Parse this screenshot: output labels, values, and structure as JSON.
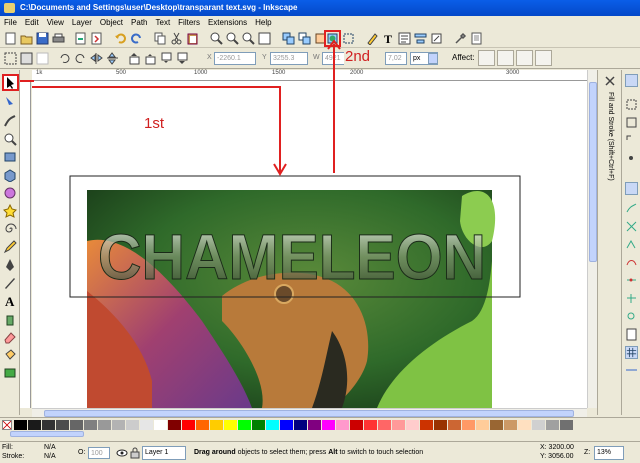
{
  "window": {
    "title": "C:\\Documents and Settings\\user\\Desktop\\transparant text.svg - Inkscape"
  },
  "menu": [
    "File",
    "Edit",
    "View",
    "Layer",
    "Object",
    "Path",
    "Text",
    "Filters",
    "Extensions",
    "Help"
  ],
  "toolbar2": {
    "x_label": "X",
    "x_value": "-2260.1",
    "y_label": "Y",
    "y_value": "3255.3",
    "w_label": "W",
    "w_value": "4921",
    "h_value": "7,02",
    "unit": "px",
    "affect_label": "Affect:"
  },
  "ruler": {
    "h_marks": [
      "1k",
      "500",
      "1000",
      "1500",
      "2000",
      "3000"
    ],
    "v_marks": [
      "1k",
      "1000",
      "1500",
      "2000",
      "2500",
      "3000"
    ]
  },
  "canvas": {
    "image_text": "CHAMELEON"
  },
  "annotations": {
    "first": "1st",
    "second": "2nd"
  },
  "dock": {
    "tab_label": "Fill and Stroke (Shift+Ctrl+F)"
  },
  "palette_colors": [
    "#000000",
    "#1a1a1a",
    "#333333",
    "#4d4d4d",
    "#666666",
    "#808080",
    "#999999",
    "#b3b3b3",
    "#cccccc",
    "#e6e6e6",
    "#ffffff",
    "#800000",
    "#ff0000",
    "#ff6600",
    "#ffcc00",
    "#ffff00",
    "#00ff00",
    "#008000",
    "#00ffff",
    "#0000ff",
    "#000080",
    "#800080",
    "#ff00ff",
    "#ff99cc",
    "#cc0000",
    "#ff3333",
    "#ff6666",
    "#ff9999",
    "#ffcccc",
    "#cc3300",
    "#993300",
    "#cc6633",
    "#ff9966",
    "#ffcc99",
    "#996633",
    "#cc9966",
    "#ffe0c0",
    "#d0d0d0",
    "#a0a0a0",
    "#707070"
  ],
  "status": {
    "fill_label": "Fill:",
    "fill_value": "N/A",
    "stroke_label": "Stroke:",
    "stroke_value": "N/A",
    "opacity_label": "O:",
    "opacity_value": "100",
    "layer": "Layer 1",
    "message_bold": "Drag around",
    "message_rest": " objects to select them; press ",
    "message_key": "Alt",
    "message_end": " to switch to touch selection",
    "x_coord": "X: 3200.00",
    "y_coord": "Y: 3056.00",
    "zoom_label": "Z:",
    "zoom_value": "13%"
  },
  "colors": {
    "accent_red": "#e02020",
    "title_blue": "#0a5ee8"
  }
}
